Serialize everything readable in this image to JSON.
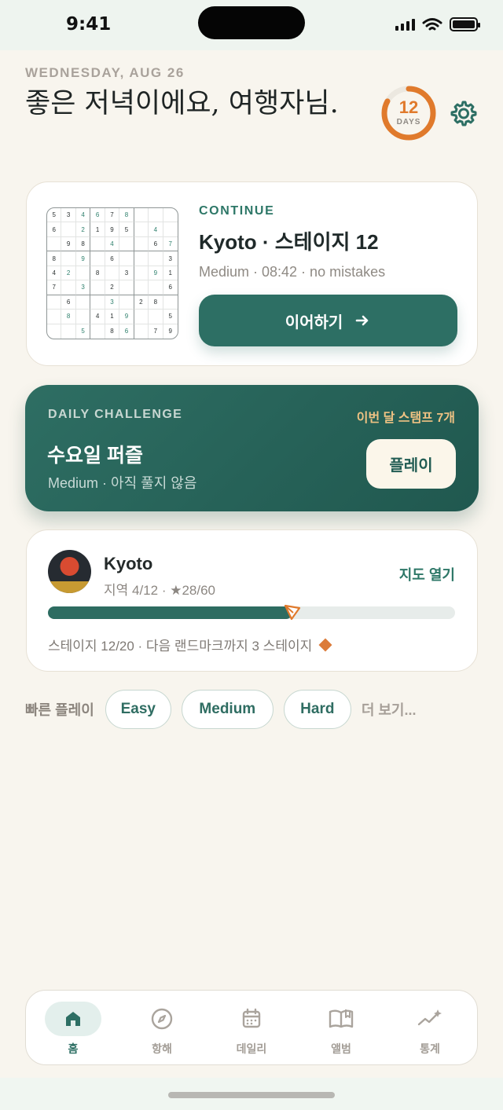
{
  "status": {
    "time": "9:41"
  },
  "header": {
    "date": "WEDNESDAY, AUG 26",
    "greeting": "좋은 저녁이에요, 여행자님.",
    "streak_count": "12",
    "streak_unit": "DAYS",
    "streak_progress": 0.83
  },
  "continue_card": {
    "kicker": "CONTINUE",
    "title": "Kyoto · 스테이지 12",
    "meta": "Medium · 08:42 · no mistakes",
    "button_label": "이어하기",
    "button_icon": "arrow-right-icon",
    "grid": [
      [
        "5",
        "3",
        "4",
        "6",
        "7",
        "8",
        "",
        "",
        ""
      ],
      [
        "6",
        "",
        "2",
        "1",
        "9",
        "5",
        "",
        "4",
        ""
      ],
      [
        "",
        "9",
        "8",
        "",
        "4",
        "",
        "",
        "6",
        "7"
      ],
      [
        "8",
        "",
        "9",
        "",
        "6",
        "",
        "",
        "",
        "3"
      ],
      [
        "4",
        "2",
        "",
        "8",
        "",
        "3",
        "",
        "9",
        "1"
      ],
      [
        "7",
        "",
        "3",
        "",
        "2",
        "",
        "",
        "",
        "6"
      ],
      [
        "",
        "6",
        "",
        "",
        "3",
        "",
        "2",
        "8",
        ""
      ],
      [
        "",
        "8",
        "",
        "4",
        "1",
        "9",
        "",
        "",
        "5"
      ],
      [
        "",
        "",
        "5",
        "",
        "8",
        "6",
        "",
        "7",
        "9"
      ]
    ],
    "green_cells": [
      "0-2",
      "0-3",
      "0-5",
      "1-2",
      "1-7",
      "2-4",
      "2-8",
      "3-2",
      "4-1",
      "4-7",
      "5-2",
      "6-4",
      "7-1",
      "7-5",
      "8-2",
      "8-5"
    ]
  },
  "daily_card": {
    "kicker": "DAILY CHALLENGE",
    "stamp_text": "이번 달 스탬프 7개",
    "title": "수요일 퍼즐",
    "meta": "Medium · 아직 풀지 않음",
    "button_label": "플레이"
  },
  "region_card": {
    "avatar_icon": "kyoto-sunset-icon",
    "name": "Kyoto",
    "meta": "지역 4/12 · ★28/60",
    "map_link": "지도 열기",
    "progress": 0.6,
    "progress_icon": "paper-plane-icon",
    "stage_text": "스테이지 12/20 · 다음 랜드마크까지 3 스테이지",
    "landmark_icon": "diamond-icon"
  },
  "quick_play": {
    "label": "빠른 플레이",
    "chips": [
      "Easy",
      "Medium",
      "Hard"
    ],
    "more": "더 보기..."
  },
  "tabs": [
    {
      "label": "홈",
      "icon": "home-icon"
    },
    {
      "label": "항해",
      "icon": "compass-icon"
    },
    {
      "label": "데일리",
      "icon": "calendar-icon"
    },
    {
      "label": "앨범",
      "icon": "book-icon"
    },
    {
      "label": "통계",
      "icon": "stats-icon"
    }
  ],
  "colors": {
    "background": "#f8f5ee",
    "accent": "#2d6f64",
    "streak": "#e07a2c",
    "stamp": "#efc283"
  }
}
